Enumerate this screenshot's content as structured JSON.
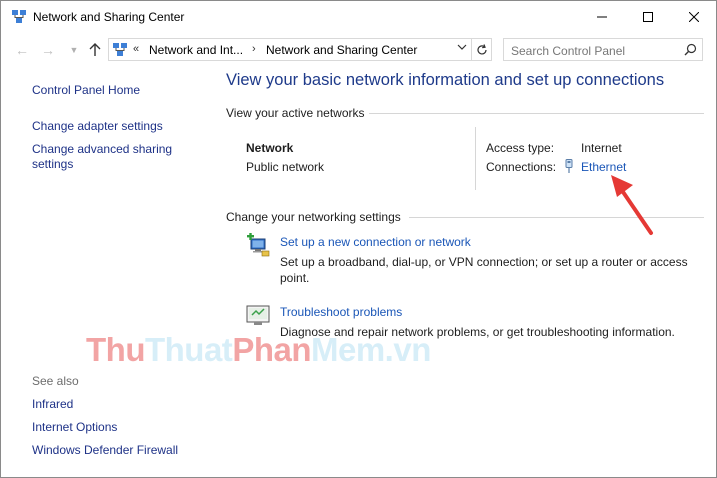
{
  "window": {
    "title": "Network and Sharing Center"
  },
  "address": {
    "overflow": "«",
    "crumb1": "Network and Int...",
    "sep": "›",
    "crumb2": "Network and Sharing Center"
  },
  "search": {
    "placeholder": "Search Control Panel"
  },
  "sidebar": {
    "home": "Control Panel Home",
    "adapter": "Change adapter settings",
    "advanced_line1": "Change advanced sharing",
    "advanced_line2": "settings",
    "see_also": "See also",
    "infrared": "Infrared",
    "internet_options": "Internet Options",
    "firewall": "Windows Defender Firewall"
  },
  "main": {
    "title": "View your basic network information and set up connections",
    "active_networks_heading": "View your active networks",
    "network_name": "Network",
    "network_type": "Public network",
    "access_type_label": "Access type:",
    "access_type_value": "Internet",
    "connections_label": "Connections:",
    "connections_value": "Ethernet",
    "change_settings_heading": "Change your networking settings",
    "task1_link": "Set up a new connection or network",
    "task1_desc": "Set up a broadband, dial-up, or VPN connection; or set up a router or access point.",
    "task2_link": "Troubleshoot problems",
    "task2_desc": "Diagnose and repair network problems, or get troubleshooting information."
  },
  "watermark": {
    "part1": "Thu",
    "part2": "Thuat",
    "part3": "Phan",
    "part4": "Mem.vn"
  },
  "colors": {
    "link": "#1a56b7",
    "sidebar_link": "#1e3287",
    "title": "#1e3a8a",
    "arrow": "#e53935"
  }
}
